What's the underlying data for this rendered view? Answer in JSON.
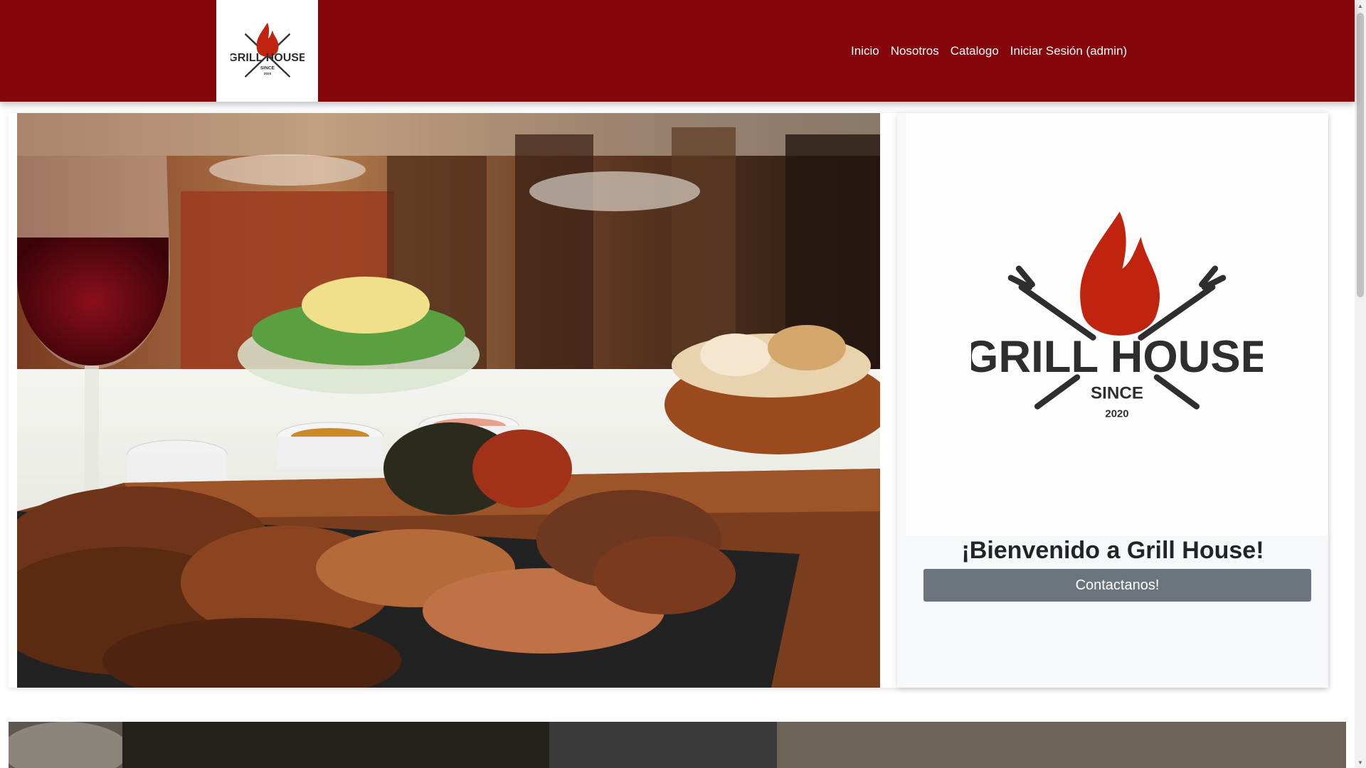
{
  "navbar": {
    "links": [
      {
        "label": "Inicio"
      },
      {
        "label": "Nosotros"
      },
      {
        "label": "Catalogo"
      },
      {
        "label": "Iniciar Sesión (admin)"
      }
    ],
    "logo": {
      "line1": "GRILL HOUSE",
      "line2": "SINCE",
      "line3": "2020"
    }
  },
  "hero": {
    "logo": {
      "line1": "GRILL HOUSE",
      "line2": "SINCE",
      "line3": "2020"
    },
    "welcome": "¡Bienvenido a Grill House!",
    "contact_button": "Contactanos!"
  },
  "colors": {
    "navbar_bg": "#84050a",
    "button_bg": "#6c757d",
    "flame": "#c0240f",
    "logo_text": "#2e2e2e"
  },
  "icons": [
    "grill-house-logo",
    "flame-icon",
    "fork-icon",
    "scroll-up-arrow-icon",
    "scroll-down-arrow-icon"
  ]
}
